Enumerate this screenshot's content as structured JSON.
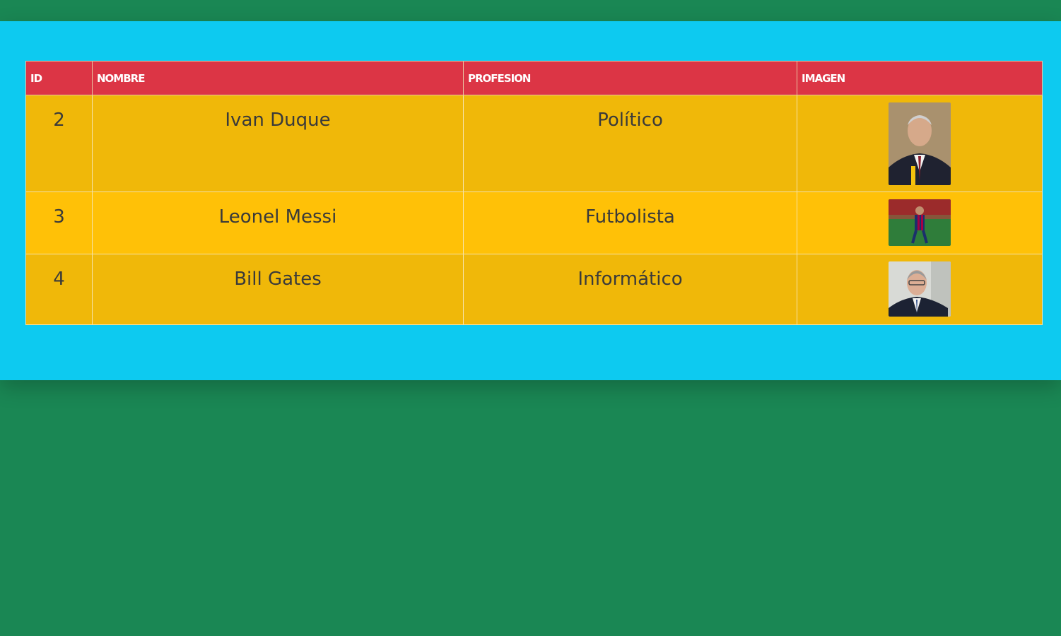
{
  "table": {
    "headers": [
      "Id",
      "NOMBRE",
      "PROFESION",
      "IMAGEN"
    ],
    "rows": [
      {
        "id": "2",
        "nombre": "Ivan Duque",
        "profesion": "Político",
        "imagen": "portrait-photo"
      },
      {
        "id": "3",
        "nombre": "Leonel Messi",
        "profesion": "Futbolista",
        "imagen": "soccer-player-photo"
      },
      {
        "id": "4",
        "nombre": "Bill Gates",
        "profesion": "Informático",
        "imagen": "portrait-photo"
      }
    ]
  },
  "colors": {
    "page_background": "#1a8754",
    "panel_background": "#0dcaf0",
    "header_background": "#dc3545",
    "row_background_dark": "#f0b809",
    "row_background_light": "#ffc107"
  }
}
